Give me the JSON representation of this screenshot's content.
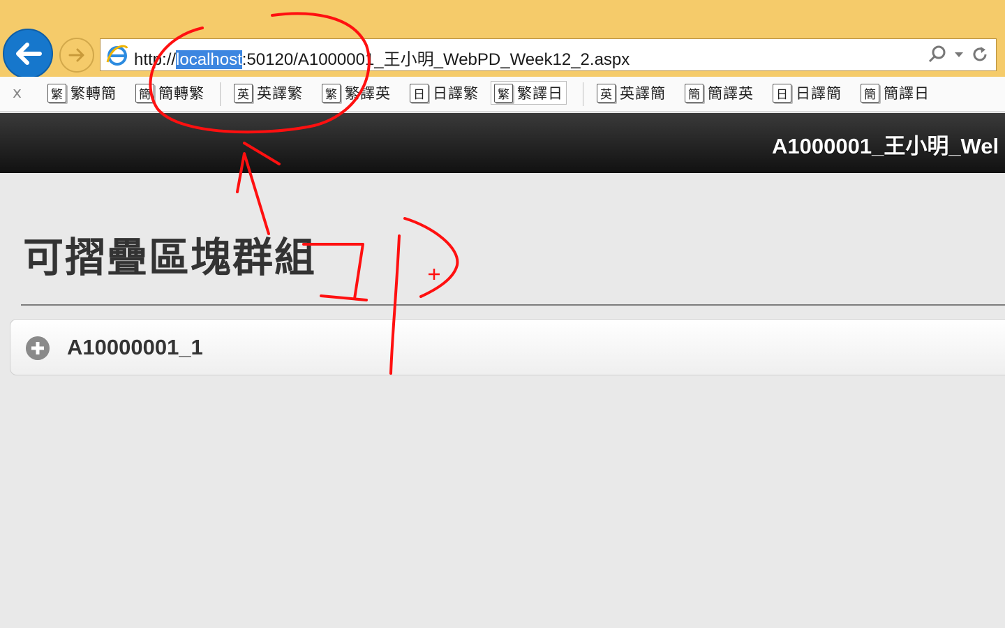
{
  "browser": {
    "url_prefix": "http://",
    "url_selected": "localhost",
    "url_suffix": ":50120/A1000001_王小明_WebPD_Week12_2.aspx"
  },
  "translate_toolbar": {
    "close_label": "x",
    "items": [
      {
        "glyph": "繁",
        "label": "繁轉簡"
      },
      {
        "glyph": "簡",
        "label": "簡轉繁"
      },
      {
        "glyph": "英",
        "label": "英譯繁"
      },
      {
        "glyph": "繁",
        "label": "繁譯英"
      },
      {
        "glyph": "日",
        "label": "日譯繁"
      },
      {
        "glyph": "繁",
        "label": "繁譯日"
      },
      {
        "glyph": "英",
        "label": "英譯簡"
      },
      {
        "glyph": "簡",
        "label": "簡譯英"
      },
      {
        "glyph": "日",
        "label": "日譯簡"
      },
      {
        "glyph": "簡",
        "label": "簡譯日"
      }
    ]
  },
  "site_header": {
    "title": "A1000001_王小明_Wel"
  },
  "content": {
    "heading": "可摺疊區塊群組",
    "collapsible": {
      "label": "A10000001_1"
    }
  },
  "colors": {
    "chrome": "#f5cb6a",
    "back_button": "#1677cc",
    "header_dark": "#111111",
    "annotation": "#ff0000",
    "url_selection": "#3c86e0"
  }
}
